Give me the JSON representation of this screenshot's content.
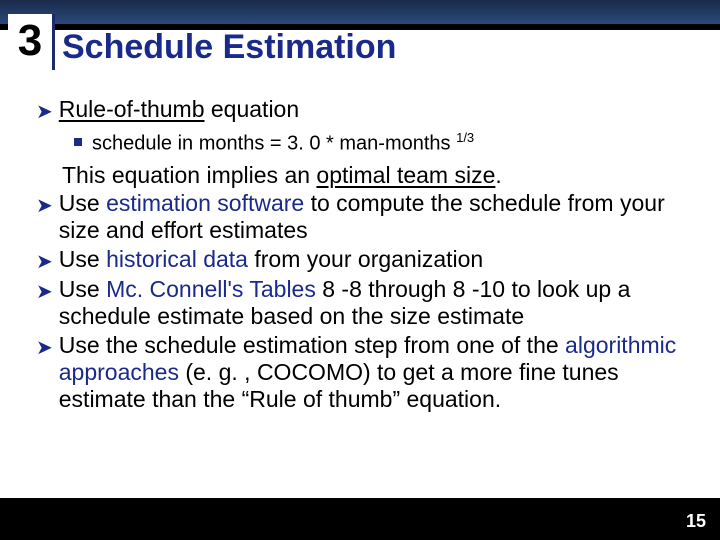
{
  "step_number": "3",
  "title": "Schedule Estimation",
  "bullet1": {
    "underlined": "Rule-of-thumb",
    "rest": " equation"
  },
  "sub1": {
    "text_before": "schedule in months = 3. 0 * man-months ",
    "exponent": "1/3"
  },
  "para1": {
    "before": "This equation implies an ",
    "underlined": "optimal team size",
    "after": "."
  },
  "bullet2": {
    "before": "Use ",
    "blue": "estimation software",
    "after": " to compute the schedule from your size and effort estimates"
  },
  "bullet3": {
    "before": "Use ",
    "blue": "historical data",
    "after": " from your organization"
  },
  "bullet4": {
    "before": "Use ",
    "blue": "Mc. Connell's Tables",
    "after": " 8 -8 through 8 -10 to look up a schedule estimate based on the size estimate"
  },
  "bullet5": {
    "before": "Use the schedule estimation step from one of the ",
    "blue": "algorithmic approaches",
    "after": " (e. g. , COCOMO) to get a more fine tunes estimate than the “Rule of thumb” equation."
  },
  "page_number": "15"
}
